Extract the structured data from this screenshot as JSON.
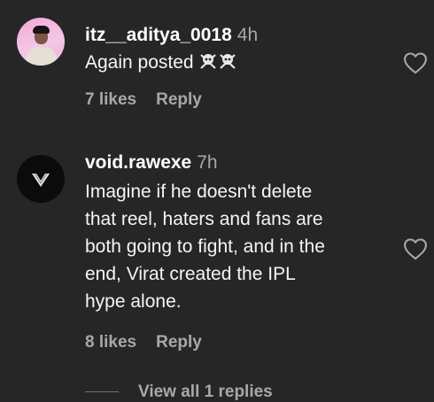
{
  "comments": [
    {
      "username": "itz__aditya_0018",
      "time": "4h",
      "text": "Again posted",
      "emoji_icons": [
        "skull-crossbones-icon",
        "skull-crossbones-icon"
      ],
      "likes": "7 likes",
      "reply": "Reply"
    },
    {
      "username": "void.rawexe",
      "time": "7h",
      "text_lines": [
        "Imagine if he doesn't delete",
        "that reel, haters and fans are",
        "both going to fight, and in the",
        "end, Virat created the IPL",
        "hype alone."
      ],
      "likes": "8 likes",
      "reply": "Reply",
      "view_replies": "View all 1 replies"
    }
  ],
  "icons": {
    "like": "heart-outline-icon"
  }
}
